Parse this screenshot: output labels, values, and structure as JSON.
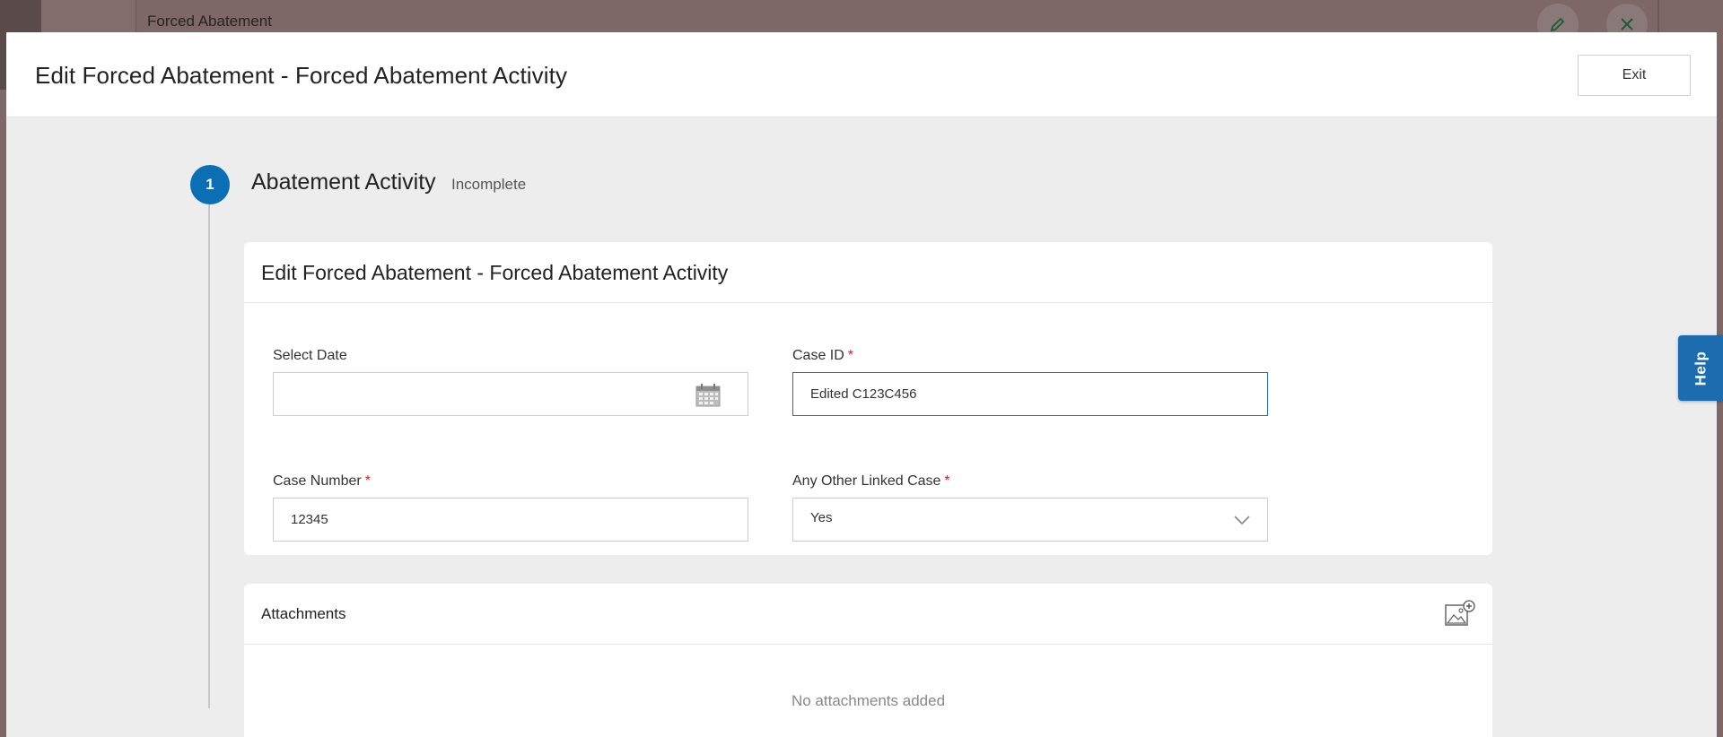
{
  "background": {
    "app_title": "Forced Abatement"
  },
  "modal": {
    "title": "Edit Forced Abatement - Forced Abatement Activity",
    "exit_label": "Exit"
  },
  "stepper": {
    "number": "1",
    "title": "Abatement Activity",
    "status": "Incomplete"
  },
  "form": {
    "title": "Edit Forced Abatement - Forced Abatement Activity",
    "select_date": {
      "label": "Select Date",
      "value": ""
    },
    "case_id": {
      "label": "Case ID",
      "required_mark": "*",
      "value": "Edited C123C456"
    },
    "case_number": {
      "label": "Case Number",
      "required_mark": "*",
      "value": "12345"
    },
    "linked_case": {
      "label": "Any Other Linked Case",
      "required_mark": "*",
      "value": "Yes"
    }
  },
  "attachments": {
    "title": "Attachments",
    "empty_text": "No attachments added"
  },
  "help": {
    "label": "Help"
  },
  "colors": {
    "accent": "#0b6fb5",
    "required": "#c0262d",
    "overlay": "#7d6867"
  }
}
